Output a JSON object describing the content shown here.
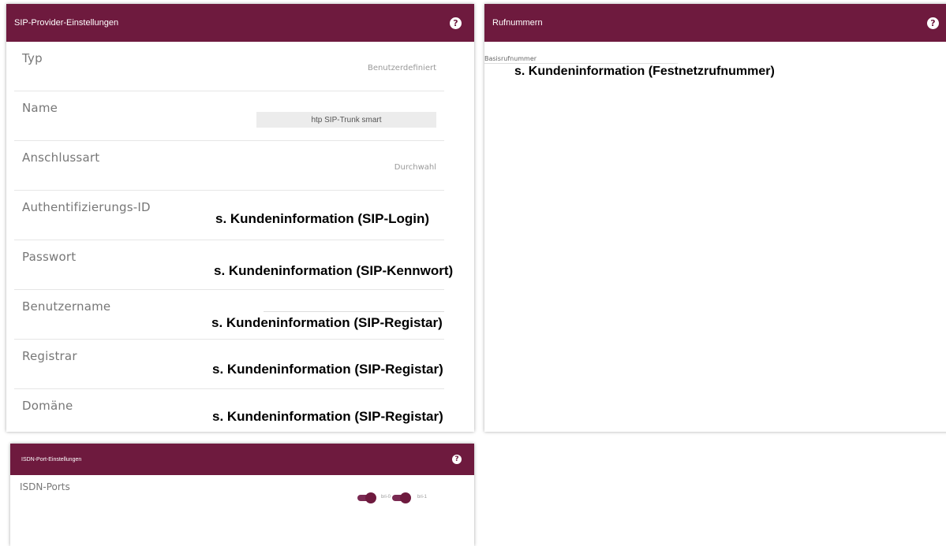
{
  "sip_panel": {
    "title": "SIP-Provider-Einstellungen",
    "help": "?",
    "rows": [
      {
        "label": "Typ",
        "value": "Benutzerdefiniert"
      },
      {
        "label": "Name",
        "value": "htp SIP-Trunk smart"
      },
      {
        "label": "Anschlussart",
        "value": "Durchwahl"
      },
      {
        "label": "Authentifizierungs-ID",
        "value": "s. Kundeninformation (SIP-Login)"
      },
      {
        "label": "Passwort",
        "value": "s. Kundeninformation (SIP-Kennwort)"
      },
      {
        "label": "Benutzername",
        "value": "s. Kundeninformation (SIP-Registar)"
      },
      {
        "label": "Registrar",
        "value": "s. Kundeninformation (SIP-Registar)"
      },
      {
        "label": "Domäne",
        "value": "s. Kundeninformation (SIP-Registar)"
      }
    ]
  },
  "rufnummern_panel": {
    "title": "Rufnummern",
    "help": "?",
    "basis_label": "Basisrufnummer",
    "basis_value": "s. Kundeninformation (Festnetzrufnummer)"
  },
  "isdn_panel": {
    "title": "ISDN-Port-Einstellungen",
    "help": "?",
    "label": "ISDN-Ports",
    "ports": [
      "bri-0",
      "bri-1"
    ]
  },
  "colors": {
    "header": "#6e1a3e",
    "toggle": "#6e1a3e"
  }
}
